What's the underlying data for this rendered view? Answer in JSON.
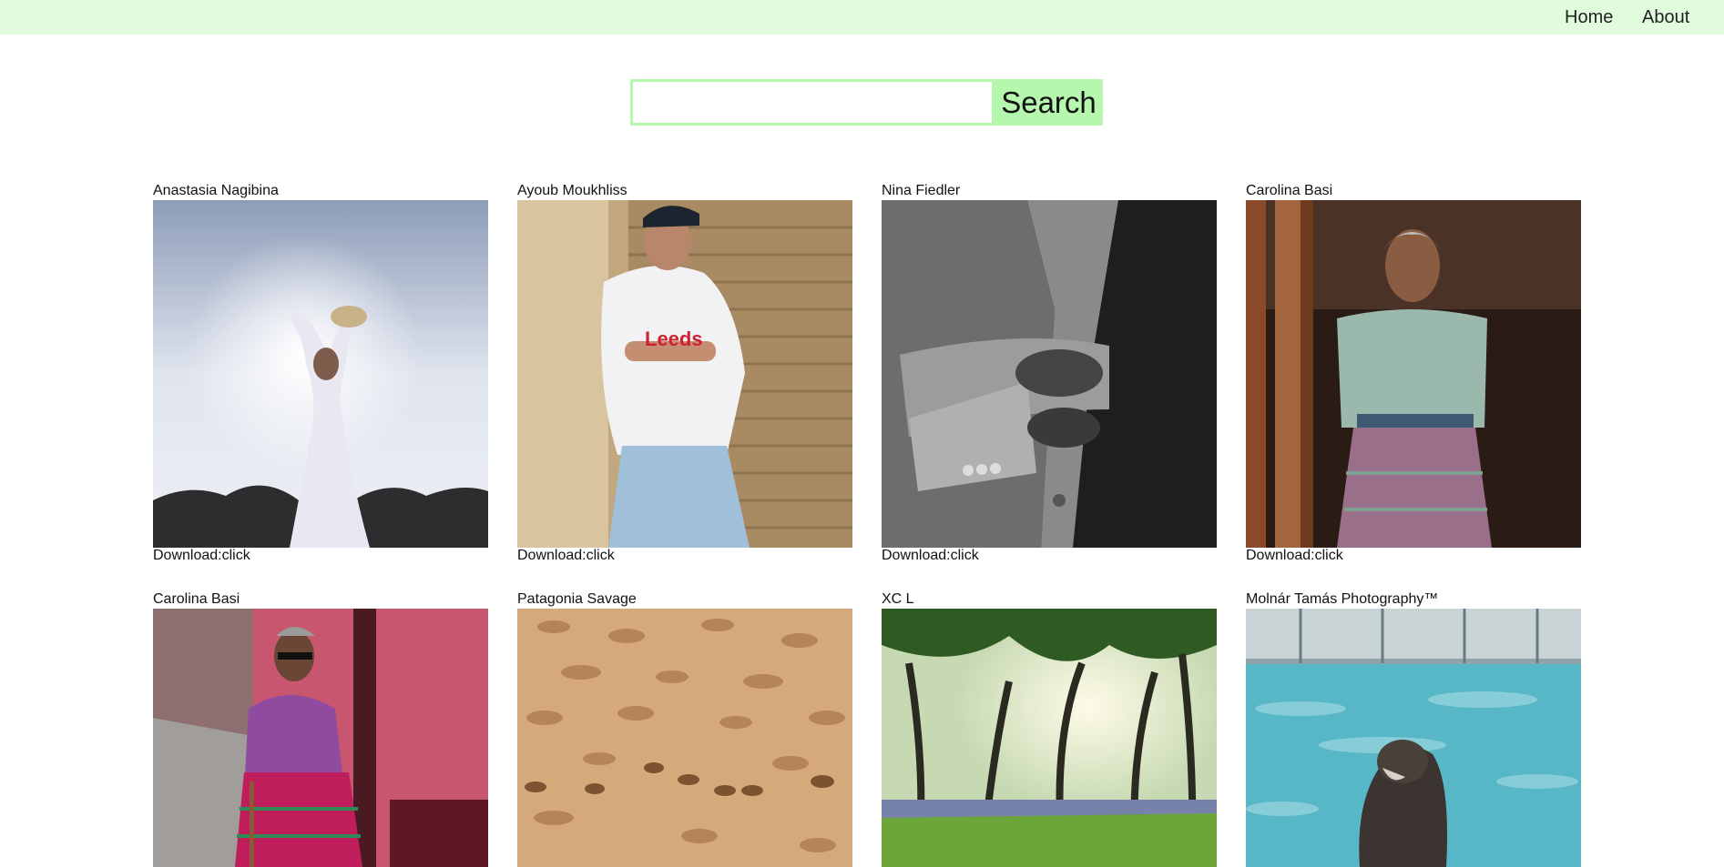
{
  "nav": {
    "home": "Home",
    "about": "About"
  },
  "search": {
    "value": "",
    "placeholder": "",
    "button_label": "Search"
  },
  "download_prefix": "Download:",
  "download_link": "click",
  "photos": [
    {
      "author": "Anastasia Nagibina",
      "icon": "woman-holding-bouquet-photo"
    },
    {
      "author": "Ayoub Moukhliss",
      "icon": "man-leaning-on-wall-photo"
    },
    {
      "author": "Nina Fiedler",
      "icon": "suit-cufflinks-photo"
    },
    {
      "author": "Carolina Basi",
      "icon": "elderly-woman-portrait-photo"
    },
    {
      "author": "Carolina Basi",
      "icon": "woman-walking-street-photo"
    },
    {
      "author": "Patagonia Savage",
      "icon": "deer-grassland-photo"
    },
    {
      "author": "XC L",
      "icon": "forest-trees-photo"
    },
    {
      "author": "Molnár Tamás Photography™",
      "icon": "sea-lion-pool-photo"
    }
  ],
  "colors": {
    "topbar": "#e1fcdc",
    "search_accent": "#b5f7ad"
  }
}
